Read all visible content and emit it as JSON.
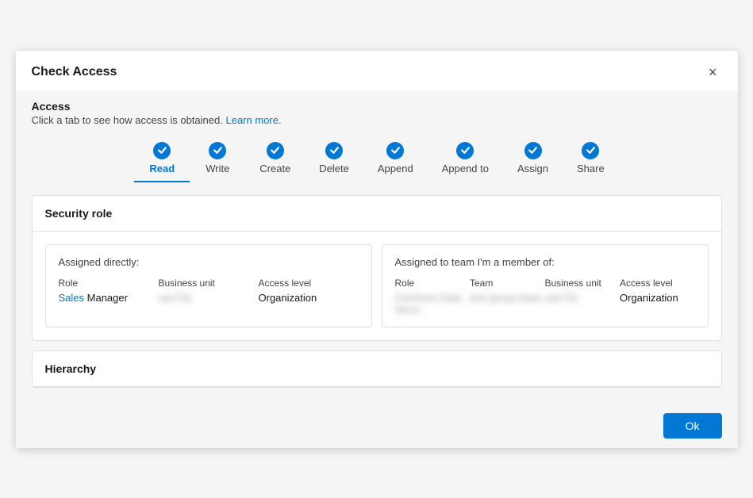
{
  "dialog": {
    "title": "Check Access",
    "close_label": "×"
  },
  "access": {
    "label": "Access",
    "description": "Click a tab to see how access is obtained.",
    "learn_more": "Learn more."
  },
  "tabs": [
    {
      "id": "read",
      "label": "Read",
      "active": true
    },
    {
      "id": "write",
      "label": "Write",
      "active": false
    },
    {
      "id": "create",
      "label": "Create",
      "active": false
    },
    {
      "id": "delete",
      "label": "Delete",
      "active": false
    },
    {
      "id": "append",
      "label": "Append",
      "active": false
    },
    {
      "id": "append-to",
      "label": "Append to",
      "active": false
    },
    {
      "id": "assign",
      "label": "Assign",
      "active": false
    },
    {
      "id": "share",
      "label": "Share",
      "active": false
    }
  ],
  "security_role": {
    "title": "Security role",
    "assigned_directly": {
      "heading": "Assigned directly:",
      "columns": [
        "Role",
        "Business unit",
        "Access level"
      ],
      "rows": [
        {
          "role_part1": "Sales",
          "role_part2": "Manager",
          "business_unit": "can731",
          "access_level": "Organization"
        }
      ]
    },
    "assigned_team": {
      "heading": "Assigned to team I'm a member of:",
      "columns": [
        "Role",
        "Team",
        "Business unit",
        "Access level"
      ],
      "rows": [
        {
          "role": "Common Data Servi...",
          "team": "test group team",
          "business_unit": "can731",
          "access_level": "Organization"
        }
      ]
    }
  },
  "hierarchy": {
    "title": "Hierarchy"
  },
  "footer": {
    "ok_label": "Ok"
  }
}
